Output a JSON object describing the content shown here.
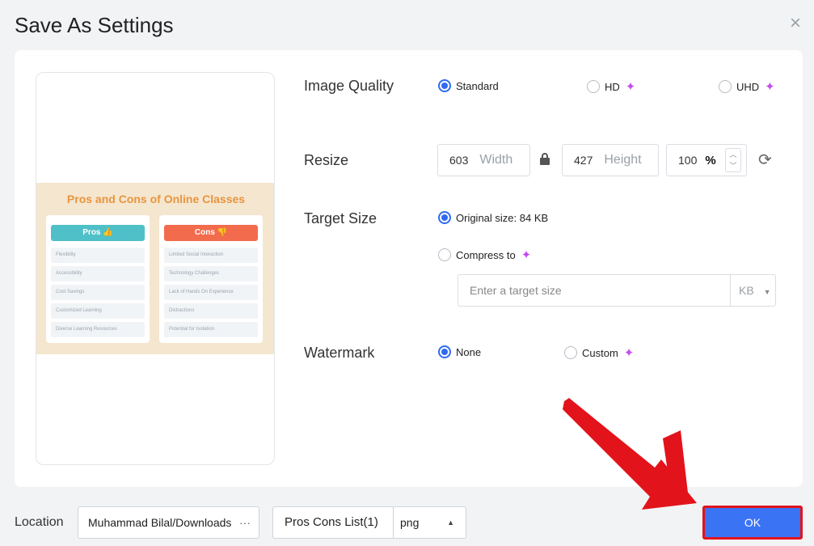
{
  "dialog": {
    "title": "Save As Settings",
    "close_icon": "close-icon"
  },
  "preview": {
    "title": "Pros and Cons of Online Classes",
    "pros_header": "Pros 👍",
    "cons_header": "Cons 👎",
    "pros": [
      "Flexibility",
      "Accessibility",
      "Cost Savings",
      "Customized Learning",
      "Diverse Learning Resources"
    ],
    "cons": [
      "Limited Social Interaction",
      "Technology Challenges",
      "Lack of Hands On Experience",
      "Distractions",
      "Potential for Isolation"
    ]
  },
  "image_quality": {
    "label": "Image Quality",
    "options": [
      "Standard",
      "HD",
      "UHD"
    ],
    "selected": "Standard"
  },
  "resize": {
    "label": "Resize",
    "width": "603",
    "width_unit": "Width",
    "height": "427",
    "height_unit": "Height",
    "percent": "100",
    "percent_unit": "%"
  },
  "target_size": {
    "label": "Target Size",
    "original": "Original size: 84 KB",
    "compress": "Compress to",
    "placeholder": "Enter a target size",
    "unit": "KB"
  },
  "watermark": {
    "label": "Watermark",
    "options": [
      "None",
      "Custom"
    ],
    "selected": "None"
  },
  "footer": {
    "location_label": "Location",
    "location_value": "Muhammad Bilal/Downloads",
    "location_more": "···",
    "file_name": "Pros Cons List(1)",
    "format": "png",
    "ok_label": "OK"
  },
  "colors": {
    "accent": "#2f6bf2",
    "ok_button": "#3b73f5",
    "premium_star": "#c64bf0",
    "highlight": "#e3131b"
  }
}
